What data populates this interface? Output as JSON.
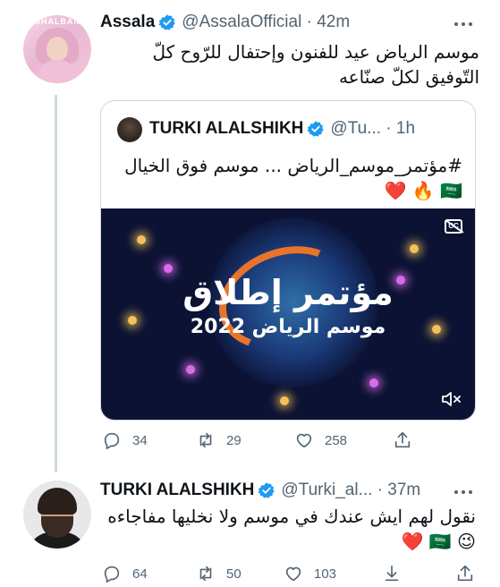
{
  "tweet1": {
    "author_name": "Assala",
    "handle_time": "@AssalaOfficial · 42m",
    "avatar_watermark": "GHALBAN",
    "text_line1": "موسم الرياض عيد للفنون وإحتفال للرّوح كلّ",
    "text_line2": "التّوفيق لكلّ صنّاعه",
    "quote": {
      "author_name": "TURKI ALALSHIKH",
      "handle_time": "@Tu... · 1h",
      "text_line1": "#مؤتمر_موسم_الرياض ... موسم فوق الخيال",
      "emoji_line": "🇸🇦 🔥 ❤️",
      "media_title": "مؤتمر إطلاق",
      "media_subtitle": "موسم الرياض 2022"
    },
    "actions": {
      "replies": "34",
      "retweets": "29",
      "likes": "258"
    }
  },
  "tweet2": {
    "author_name": "TURKI ALALSHIKH",
    "handle_time": "@Turki_al... · 37m",
    "text_line1": "نقول لهم ايش عندك في موسم ولا نخليها مفاجاءه",
    "emoji_line": "😉 🇸🇦 ❤️",
    "actions": {
      "replies": "64",
      "retweets": "50",
      "likes": "103"
    }
  },
  "colors": {
    "verified": "#1d9bf0",
    "text": "#0f1419",
    "muted": "#536471",
    "border": "#cfd9de"
  },
  "icons": [
    "verified-badge-icon",
    "more-icon",
    "reply-icon",
    "retweet-icon",
    "like-icon",
    "share-icon",
    "captions-off-icon",
    "volume-off-icon"
  ]
}
